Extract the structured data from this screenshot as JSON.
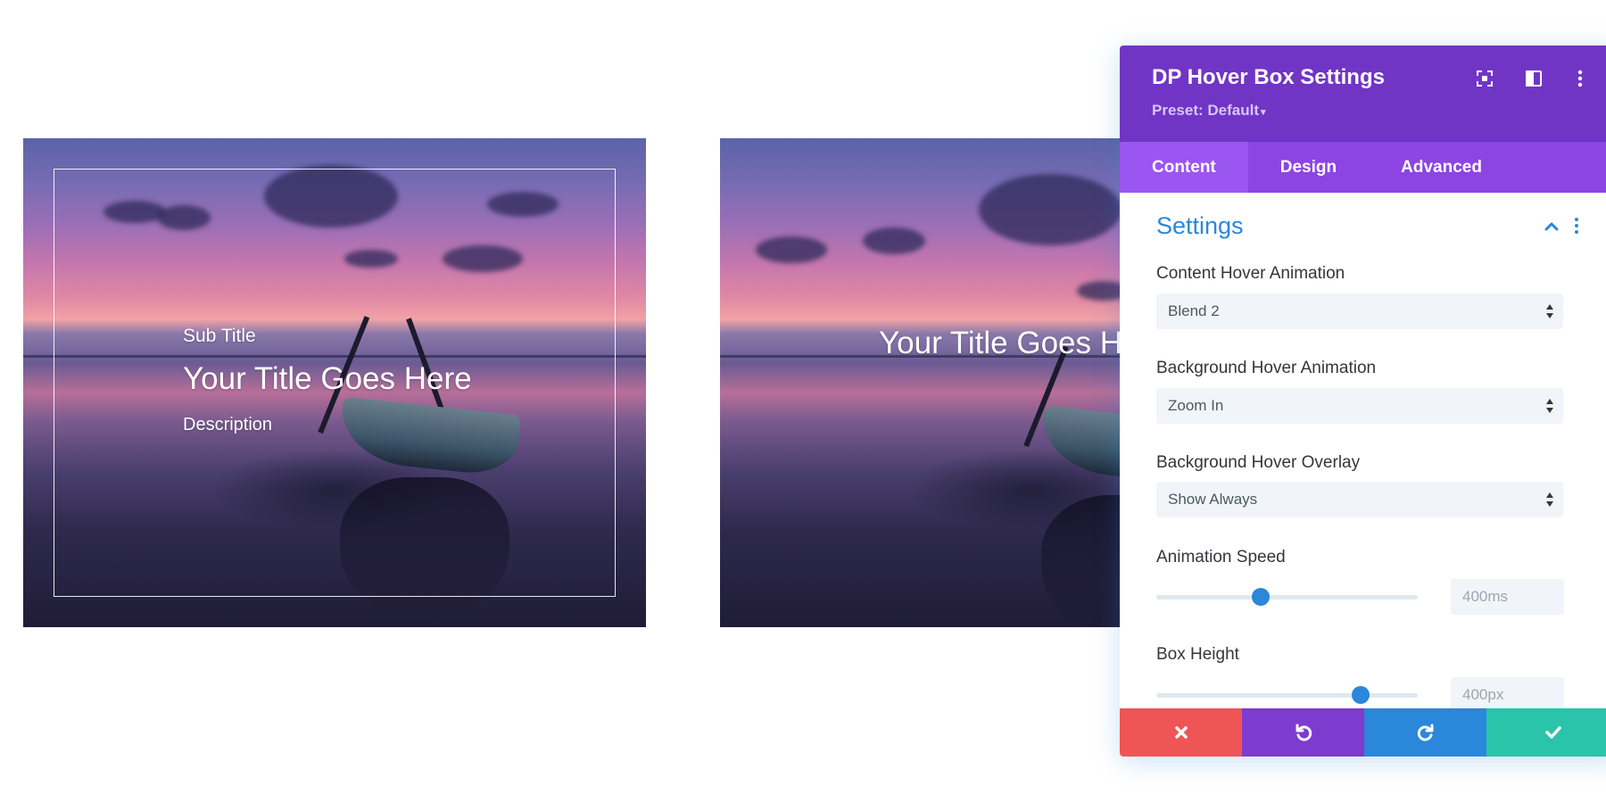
{
  "preview": {
    "box1": {
      "sub_title": "Sub Title",
      "title": "Your Title Goes Here",
      "description": "Description"
    },
    "box2": {
      "title": "Your Title Goes Here"
    }
  },
  "modal": {
    "title": "DP Hover Box Settings",
    "preset_label": "Preset: Default",
    "header_icons": [
      "focus-icon",
      "sidebar-layout-icon",
      "more-vertical-icon"
    ],
    "tabs": [
      {
        "label": "Content",
        "active": true
      },
      {
        "label": "Design",
        "active": false
      },
      {
        "label": "Advanced",
        "active": false
      }
    ],
    "section": {
      "title": "Settings",
      "expanded": true
    },
    "fields": {
      "content_hover_animation": {
        "label": "Content Hover Animation",
        "value": "Blend 2"
      },
      "background_hover_animation": {
        "label": "Background Hover Animation",
        "value": "Zoom In"
      },
      "background_hover_overlay": {
        "label": "Background Hover Overlay",
        "value": "Show Always"
      },
      "animation_speed": {
        "label": "Animation Speed",
        "value": "400ms",
        "slider_fraction": 0.4
      },
      "box_height": {
        "label": "Box Height",
        "value": "400px",
        "slider_fraction": 0.78
      }
    },
    "footer": {
      "buttons": [
        "cancel-button",
        "undo-button",
        "redo-button",
        "save-button"
      ]
    },
    "colors": {
      "header": "#7135c6",
      "tabs": "#8c44e3",
      "accent_blue": "#2b87da",
      "cancel": "#ef5555",
      "undo": "#7e3bd0",
      "redo": "#2b87da",
      "save": "#29c4a9"
    }
  }
}
